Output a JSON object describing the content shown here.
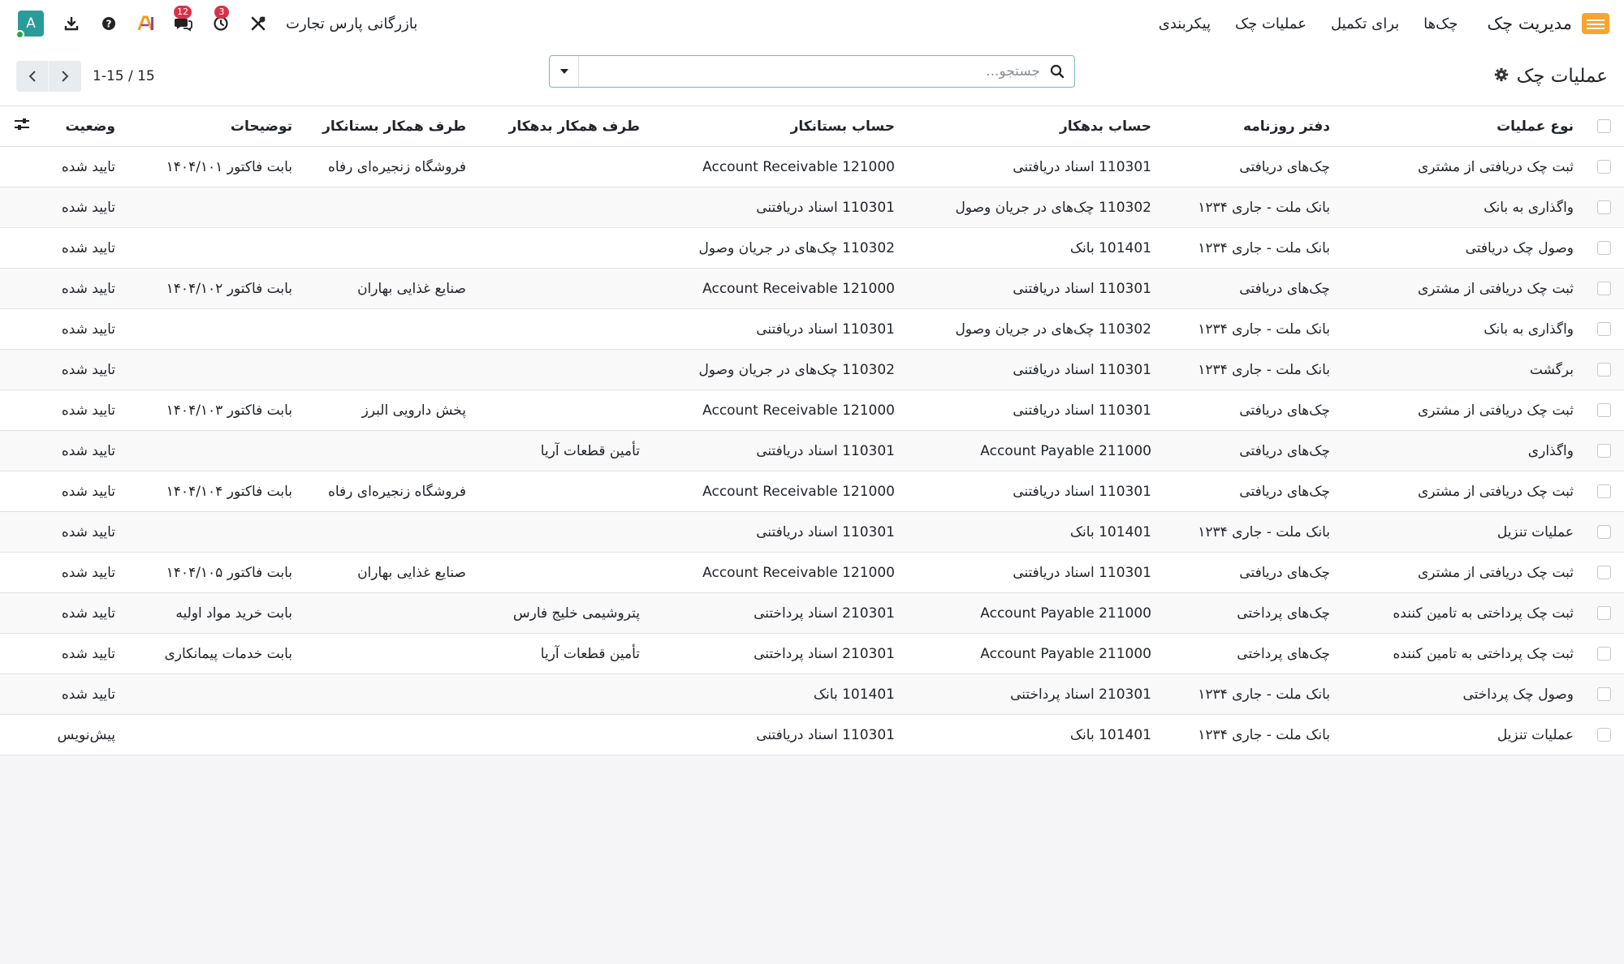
{
  "navbar": {
    "app_name": "مدیریت چک",
    "menu": [
      "چک‌ها",
      "برای تکمیل",
      "عملیات چک",
      "پیکربندی"
    ],
    "company": "بازرگانی پارس تجارت",
    "messages_count": "12",
    "activities_count": "3",
    "avatar_letter": "A"
  },
  "control_panel": {
    "title": "عملیات چک",
    "search_placeholder": "جستجو...",
    "pager_value": "1-15 / 15"
  },
  "table": {
    "headers": {
      "operation_type": "نوع عملیات",
      "journal": "دفتر روزنامه",
      "debit_account": "حساب بدهکار",
      "credit_account": "حساب بستانکار",
      "debit_partner": "طرف همکار بدهکار",
      "credit_partner": "طرف همکار بستانکار",
      "description": "توضیحات",
      "status": "وضعیت"
    },
    "rows": [
      {
        "operation_type": "ثبت چک دریافتی از مشتری",
        "journal": "چک‌های دریافتی",
        "debit_account": "110301 اسناد دریافتنی",
        "credit_account": "121000 Account Receivable",
        "debit_partner": "",
        "credit_partner": "فروشگاه زنجیره‌ای رفاه",
        "description": "بابت فاکتور ۱۴۰۴/۱۰۱",
        "status": "تایید شده"
      },
      {
        "operation_type": "واگذاری به بانک",
        "journal": "بانک ملت - جاری ۱۲۳۴",
        "debit_account": "110302 چک‌های در جریان وصول",
        "credit_account": "110301 اسناد دریافتنی",
        "debit_partner": "",
        "credit_partner": "",
        "description": "",
        "status": "تایید شده"
      },
      {
        "operation_type": "وصول چک دریافتی",
        "journal": "بانک ملت - جاری ۱۲۳۴",
        "debit_account": "101401 بانک",
        "credit_account": "110302 چک‌های در جریان وصول",
        "debit_partner": "",
        "credit_partner": "",
        "description": "",
        "status": "تایید شده"
      },
      {
        "operation_type": "ثبت چک دریافتی از مشتری",
        "journal": "چک‌های دریافتی",
        "debit_account": "110301 اسناد دریافتنی",
        "credit_account": "121000 Account Receivable",
        "debit_partner": "",
        "credit_partner": "صنایع غذایی بهاران",
        "description": "بابت فاکتور ۱۴۰۴/۱۰۲",
        "status": "تایید شده"
      },
      {
        "operation_type": "واگذاری به بانک",
        "journal": "بانک ملت - جاری ۱۲۳۴",
        "debit_account": "110302 چک‌های در جریان وصول",
        "credit_account": "110301 اسناد دریافتنی",
        "debit_partner": "",
        "credit_partner": "",
        "description": "",
        "status": "تایید شده"
      },
      {
        "operation_type": "برگشت",
        "journal": "بانک ملت - جاری ۱۲۳۴",
        "debit_account": "110301 اسناد دریافتنی",
        "credit_account": "110302 چک‌های در جریان وصول",
        "debit_partner": "",
        "credit_partner": "",
        "description": "",
        "status": "تایید شده"
      },
      {
        "operation_type": "ثبت چک دریافتی از مشتری",
        "journal": "چک‌های دریافتی",
        "debit_account": "110301 اسناد دریافتنی",
        "credit_account": "121000 Account Receivable",
        "debit_partner": "",
        "credit_partner": "پخش دارویی البرز",
        "description": "بابت فاکتور ۱۴۰۴/۱۰۳",
        "status": "تایید شده"
      },
      {
        "operation_type": "واگذاری",
        "journal": "چک‌های دریافتی",
        "debit_account": "211000 Account Payable",
        "credit_account": "110301 اسناد دریافتنی",
        "debit_partner": "تأمین قطعات آریا",
        "credit_partner": "",
        "description": "",
        "status": "تایید شده"
      },
      {
        "operation_type": "ثبت چک دریافتی از مشتری",
        "journal": "چک‌های دریافتی",
        "debit_account": "110301 اسناد دریافتنی",
        "credit_account": "121000 Account Receivable",
        "debit_partner": "",
        "credit_partner": "فروشگاه زنجیره‌ای رفاه",
        "description": "بابت فاکتور ۱۴۰۴/۱۰۴",
        "status": "تایید شده"
      },
      {
        "operation_type": "عملیات تنزیل",
        "journal": "بانک ملت - جاری ۱۲۳۴",
        "debit_account": "101401 بانک",
        "credit_account": "110301 اسناد دریافتنی",
        "debit_partner": "",
        "credit_partner": "",
        "description": "",
        "status": "تایید شده"
      },
      {
        "operation_type": "ثبت چک دریافتی از مشتری",
        "journal": "چک‌های دریافتی",
        "debit_account": "110301 اسناد دریافتنی",
        "credit_account": "121000 Account Receivable",
        "debit_partner": "",
        "credit_partner": "صنایع غذایی بهاران",
        "description": "بابت فاکتور ۱۴۰۴/۱۰۵",
        "status": "تایید شده"
      },
      {
        "operation_type": "ثبت چک پرداختی به تامین کننده",
        "journal": "چک‌های پرداختی",
        "debit_account": "211000 Account Payable",
        "credit_account": "210301 اسناد پرداختنی",
        "debit_partner": "پتروشیمی خلیج فارس",
        "credit_partner": "",
        "description": "بابت خرید مواد اولیه",
        "status": "تایید شده"
      },
      {
        "operation_type": "ثبت چک پرداختی به تامین کننده",
        "journal": "چک‌های پرداختی",
        "debit_account": "211000 Account Payable",
        "credit_account": "210301 اسناد پرداختنی",
        "debit_partner": "تأمین قطعات آریا",
        "credit_partner": "",
        "description": "بابت خدمات پیمانکاری",
        "status": "تایید شده"
      },
      {
        "operation_type": "وصول چک پرداختی",
        "journal": "بانک ملت - جاری ۱۲۳۴",
        "debit_account": "210301 اسناد پرداختنی",
        "credit_account": "101401 بانک",
        "debit_partner": "",
        "credit_partner": "",
        "description": "",
        "status": "تایید شده"
      },
      {
        "operation_type": "عملیات تنزیل",
        "journal": "بانک ملت - جاری ۱۲۳۴",
        "debit_account": "101401 بانک",
        "credit_account": "110301 اسناد دریافتنی",
        "debit_partner": "",
        "credit_partner": "",
        "description": "",
        "status": "پیش‌نویس"
      }
    ]
  },
  "colors": {
    "accent": "#2a9b9b",
    "badge": "#d9324a",
    "app_icon": "#f7a531",
    "search_border": "#7ab8c4"
  }
}
